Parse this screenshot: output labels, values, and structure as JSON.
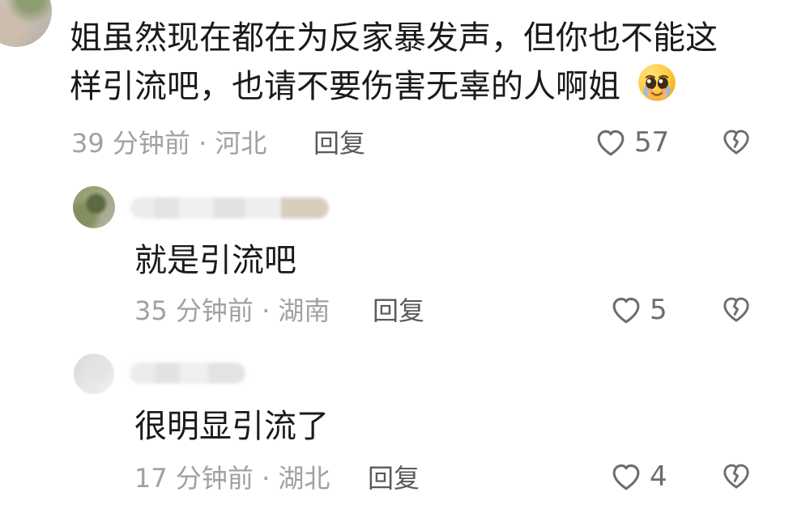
{
  "comment": {
    "line1": "姐虽然现在都在为反家暴发声，但你也不能这",
    "line2": "样引流吧，也请不要伤害无辜的人啊姐",
    "emoji_icon": "pleading-face-icon",
    "meta": "39 分钟前 · 河北",
    "reply_label": "回复",
    "like_count": "57",
    "like_icon": "heart-outline-icon",
    "dislike_icon": "broken-heart-outline-icon"
  },
  "replies": [
    {
      "text": "就是引流吧",
      "meta": "35 分钟前 · 湖南",
      "reply_label": "回复",
      "like_count": "5"
    },
    {
      "text": "很明显引流了",
      "meta": "17 分钟前 · 湖北",
      "reply_label": "回复",
      "like_count": "4"
    }
  ],
  "colors": {
    "text_primary": "#1a1a1a",
    "text_secondary": "#a1a1a1",
    "icon_stroke": "#6d6d6d",
    "background": "#ffffff"
  }
}
